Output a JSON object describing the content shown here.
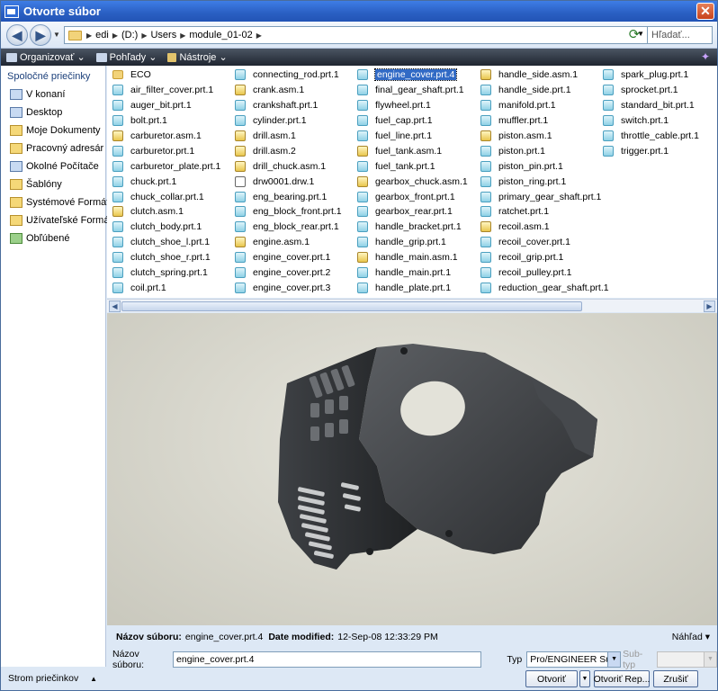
{
  "window": {
    "title": "Otvorte súbor"
  },
  "nav": {
    "breadcrumbs": [
      "edi",
      "(D:)",
      "Users",
      "module_01-02"
    ],
    "search_placeholder": "Hľadať..."
  },
  "toolbar": {
    "organize": "Organizovať",
    "views": "Pohľady",
    "tools": "Nástroje"
  },
  "sidebar": {
    "heading": "Spoločné priečinky",
    "items": [
      {
        "label": "V konaní",
        "icon": "session-icon"
      },
      {
        "label": "Desktop",
        "icon": "desktop-icon"
      },
      {
        "label": "Moje Dokumenty",
        "icon": "documents-icon"
      },
      {
        "label": "Pracovný adresár",
        "icon": "working-dir-icon"
      },
      {
        "label": "Okolné Počítače",
        "icon": "network-icon"
      },
      {
        "label": "Šablóny",
        "icon": "templates-icon"
      },
      {
        "label": "Systémové Formáty",
        "icon": "system-formats-icon"
      },
      {
        "label": "Užívateľské Formáty",
        "icon": "user-formats-icon"
      },
      {
        "label": "Obľúbené",
        "icon": "favorites-icon"
      }
    ],
    "tree_toggle": "Strom priečinkov"
  },
  "files": {
    "columns": [
      [
        {
          "name": "ECO",
          "type": "folder"
        },
        {
          "name": "air_filter_cover.prt.1",
          "type": "prt"
        },
        {
          "name": "auger_bit.prt.1",
          "type": "prt"
        },
        {
          "name": "bolt.prt.1",
          "type": "prt"
        },
        {
          "name": "carburetor.asm.1",
          "type": "asm"
        },
        {
          "name": "carburetor.prt.1",
          "type": "prt"
        },
        {
          "name": "carburetor_plate.prt.1",
          "type": "prt"
        },
        {
          "name": "chuck.prt.1",
          "type": "prt"
        },
        {
          "name": "chuck_collar.prt.1",
          "type": "prt"
        },
        {
          "name": "clutch.asm.1",
          "type": "asm"
        },
        {
          "name": "clutch_body.prt.1",
          "type": "prt"
        },
        {
          "name": "clutch_shoe_l.prt.1",
          "type": "prt"
        },
        {
          "name": "clutch_shoe_r.prt.1",
          "type": "prt"
        },
        {
          "name": "clutch_spring.prt.1",
          "type": "prt"
        },
        {
          "name": "coil.prt.1",
          "type": "prt"
        }
      ],
      [
        {
          "name": "connecting_rod.prt.1",
          "type": "prt"
        },
        {
          "name": "crank.asm.1",
          "type": "asm"
        },
        {
          "name": "crankshaft.prt.1",
          "type": "prt"
        },
        {
          "name": "cylinder.prt.1",
          "type": "prt"
        },
        {
          "name": "drill.asm.1",
          "type": "asm"
        },
        {
          "name": "drill.asm.2",
          "type": "asm"
        },
        {
          "name": "drill_chuck.asm.1",
          "type": "asm"
        },
        {
          "name": "drw0001.drw.1",
          "type": "drw"
        },
        {
          "name": "eng_bearing.prt.1",
          "type": "prt"
        },
        {
          "name": "eng_block_front.prt.1",
          "type": "prt"
        },
        {
          "name": "eng_block_rear.prt.1",
          "type": "prt"
        },
        {
          "name": "engine.asm.1",
          "type": "asm"
        },
        {
          "name": "engine_cover.prt.1",
          "type": "prt"
        },
        {
          "name": "engine_cover.prt.2",
          "type": "prt"
        },
        {
          "name": "engine_cover.prt.3",
          "type": "prt"
        }
      ],
      [
        {
          "name": "engine_cover.prt.4",
          "type": "prt",
          "selected": true
        },
        {
          "name": "final_gear_shaft.prt.1",
          "type": "prt"
        },
        {
          "name": "flywheel.prt.1",
          "type": "prt"
        },
        {
          "name": "fuel_cap.prt.1",
          "type": "prt"
        },
        {
          "name": "fuel_line.prt.1",
          "type": "prt"
        },
        {
          "name": "fuel_tank.asm.1",
          "type": "asm"
        },
        {
          "name": "fuel_tank.prt.1",
          "type": "prt"
        },
        {
          "name": "gearbox_chuck.asm.1",
          "type": "asm"
        },
        {
          "name": "gearbox_front.prt.1",
          "type": "prt"
        },
        {
          "name": "gearbox_rear.prt.1",
          "type": "prt"
        },
        {
          "name": "handle_bracket.prt.1",
          "type": "prt"
        },
        {
          "name": "handle_grip.prt.1",
          "type": "prt"
        },
        {
          "name": "handle_main.asm.1",
          "type": "asm"
        },
        {
          "name": "handle_main.prt.1",
          "type": "prt"
        },
        {
          "name": "handle_plate.prt.1",
          "type": "prt"
        }
      ],
      [
        {
          "name": "handle_side.asm.1",
          "type": "asm"
        },
        {
          "name": "handle_side.prt.1",
          "type": "prt"
        },
        {
          "name": "manifold.prt.1",
          "type": "prt"
        },
        {
          "name": "muffler.prt.1",
          "type": "prt"
        },
        {
          "name": "piston.asm.1",
          "type": "asm"
        },
        {
          "name": "piston.prt.1",
          "type": "prt"
        },
        {
          "name": "piston_pin.prt.1",
          "type": "prt"
        },
        {
          "name": "piston_ring.prt.1",
          "type": "prt"
        },
        {
          "name": "primary_gear_shaft.prt.1",
          "type": "prt"
        },
        {
          "name": "ratchet.prt.1",
          "type": "prt"
        },
        {
          "name": "recoil.asm.1",
          "type": "asm"
        },
        {
          "name": "recoil_cover.prt.1",
          "type": "prt"
        },
        {
          "name": "recoil_grip.prt.1",
          "type": "prt"
        },
        {
          "name": "recoil_pulley.prt.1",
          "type": "prt"
        },
        {
          "name": "reduction_gear_shaft.prt.1",
          "type": "prt"
        }
      ],
      [
        {
          "name": "spark_plug.prt.1",
          "type": "prt"
        },
        {
          "name": "sprocket.prt.1",
          "type": "prt"
        },
        {
          "name": "standard_bit.prt.1",
          "type": "prt"
        },
        {
          "name": "switch.prt.1",
          "type": "prt"
        },
        {
          "name": "throttle_cable.prt.1",
          "type": "prt"
        },
        {
          "name": "trigger.prt.1",
          "type": "prt"
        }
      ]
    ]
  },
  "info": {
    "file_name_label": "Názov súboru:",
    "file_name_value": "engine_cover.prt.4",
    "date_label": "Date modified:",
    "date_value": "12-Sep-08 12:33:29 PM",
    "preview_toggle": "Náhľad"
  },
  "form": {
    "file_name_label": "Názov súboru:",
    "file_name_value": "engine_cover.prt.4",
    "type_label": "Typ",
    "type_value": "Pro/ENGINEER Súbor",
    "subtype_label": "Sub-typ"
  },
  "buttons": {
    "open": "Otvoriť",
    "open_rep": "Otvoriť Rep...",
    "cancel": "Zrušiť"
  }
}
